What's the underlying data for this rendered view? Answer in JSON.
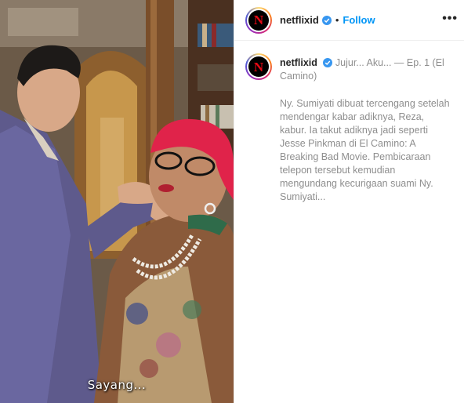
{
  "header": {
    "username": "netflixid",
    "dot": "•",
    "follow_label": "Follow",
    "more_label": "•••",
    "avatar_letter": "N"
  },
  "caption": {
    "username": "netflixid",
    "title": "Jujur... Aku... — Ep. 1 (El Camino)",
    "text": "Ny. Sumiyati dibuat tercengang setelah mendengar kabar adiknya, Reza, kabur. Ia takut adiknya jadi seperti Jesse Pinkman di El Camino: A Breaking Bad Movie. Pembicaraan telepon tersebut kemudian mengundang kecurigaan suami Ny. Sumiyati..."
  },
  "media": {
    "subtitle": "Sayang..."
  },
  "colors": {
    "follow": "#0095f6",
    "verified": "#3897f0",
    "brand_red": "#e50914",
    "muted_text": "#8e8e8e"
  }
}
